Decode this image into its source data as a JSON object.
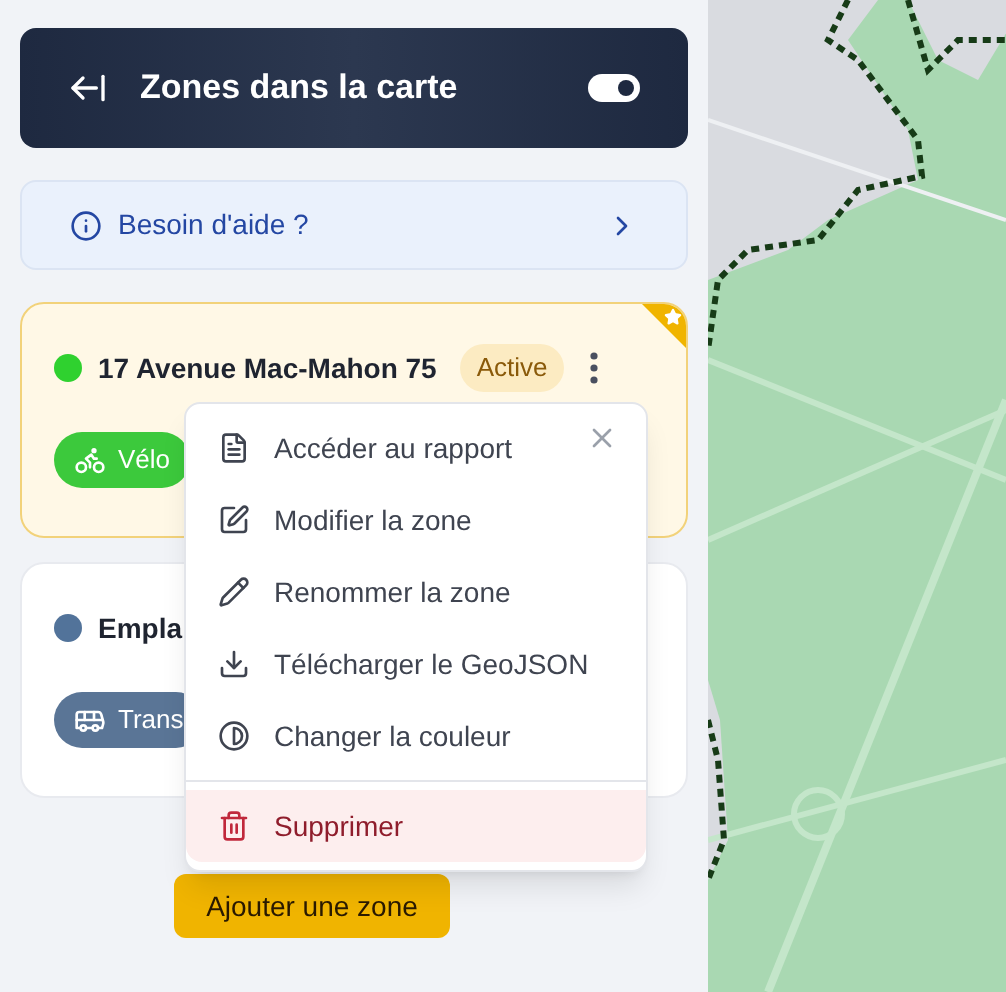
{
  "header": {
    "title": "Zones dans la carte",
    "toggle_on": true
  },
  "help": {
    "label": "Besoin d'aide ?"
  },
  "zones": [
    {
      "name": "17 Avenue Mac-Mahon 75",
      "color": "#2fd12f",
      "status": "Active",
      "highlighted": true,
      "starred": true,
      "more_button": true,
      "mode": {
        "label": "Vélo",
        "kind": "bike",
        "color": "#3cc93c"
      }
    },
    {
      "name": "Empla",
      "color": "#52739a",
      "highlighted": false,
      "starred": false,
      "more_button": false,
      "mode": {
        "label": "Trans",
        "kind": "bus",
        "color": "#5a7596"
      }
    }
  ],
  "menu": {
    "items": [
      {
        "label": "Accéder au rapport",
        "kind": "normal"
      },
      {
        "label": "Modifier la zone",
        "kind": "normal"
      },
      {
        "label": "Renommer la zone",
        "kind": "normal"
      },
      {
        "label": "Télécharger le GeoJSON",
        "kind": "normal"
      },
      {
        "label": "Changer la couleur",
        "kind": "normal"
      },
      {
        "label": "Supprimer",
        "kind": "danger"
      }
    ]
  },
  "add_button": {
    "label": "Ajouter une zone"
  }
}
